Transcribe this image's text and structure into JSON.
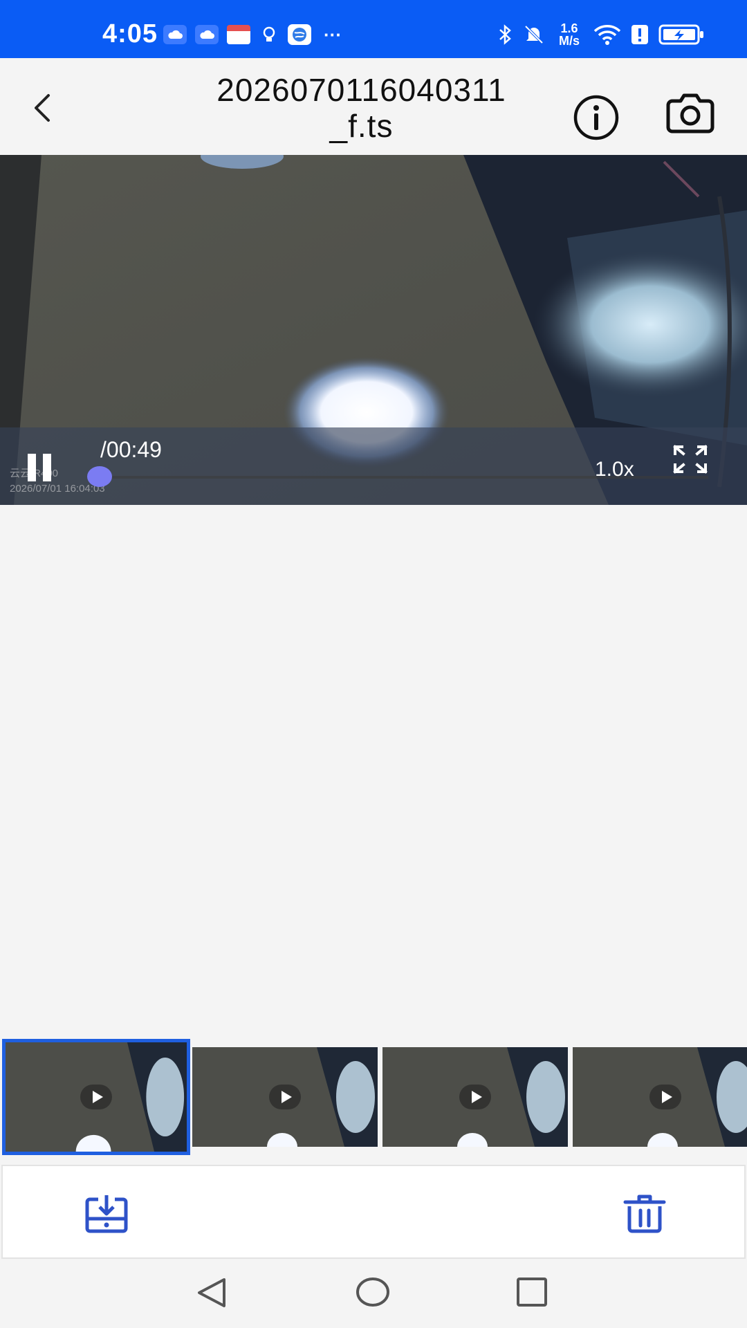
{
  "status_bar": {
    "time": "4:05",
    "left_icons": [
      "cloud-icon",
      "cloud-icon",
      "calendar-icon",
      "lightbulb-icon",
      "browser-icon"
    ],
    "more": "···",
    "net_speed_value": "1.6",
    "net_speed_unit": "M/s",
    "right_icons": [
      "bluetooth-icon",
      "bell-muted-icon",
      "wifi-icon",
      "alert-sim-icon",
      "battery-charging-icon"
    ]
  },
  "header": {
    "title": "20260701160403 11 _f.ts",
    "title_line1": "2026070116040311",
    "title_line2": "_f.ts",
    "icons": [
      "back-arrow-icon",
      "info-icon",
      "camera-icon"
    ]
  },
  "player": {
    "time_display": "/00:49",
    "speed": "1.0x",
    "progress_fraction": 0.0,
    "watermark_line1": "云云 R400",
    "watermark_line2": "2026/07/01 16:04:03",
    "icons": [
      "pause-icon",
      "fullscreen-icon"
    ]
  },
  "thumbnails": [
    {
      "selected": true
    },
    {
      "selected": false
    },
    {
      "selected": false
    },
    {
      "selected": false
    }
  ],
  "actions": {
    "icons": [
      "download-icon",
      "trash-icon"
    ]
  },
  "nav": {
    "icons": [
      "nav-back-icon",
      "nav-home-icon",
      "nav-recents-icon"
    ]
  },
  "colors": {
    "status_bar": "#0a5cf5",
    "accent": "#1f5fe0",
    "progress_knob": "#7b7cf2",
    "icon_blue": "#2e52c8"
  }
}
